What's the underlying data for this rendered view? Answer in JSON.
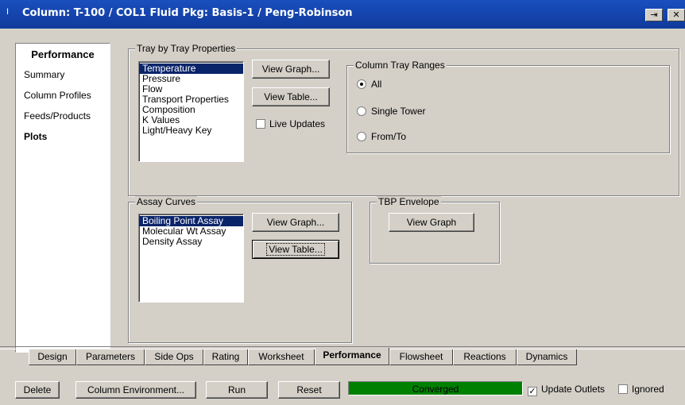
{
  "window": {
    "title": "Column: T-100 / COL1 Fluid Pkg: Basis-1 / Peng-Robinson",
    "app_icon": "I"
  },
  "sidebar": {
    "header": "Performance",
    "items": [
      {
        "label": "Summary"
      },
      {
        "label": "Column Profiles"
      },
      {
        "label": "Feeds/Products"
      },
      {
        "label": "Plots"
      }
    ],
    "active": "Plots"
  },
  "tray_props": {
    "legend": "Tray by Tray Properties",
    "items": [
      "Temperature",
      "Pressure",
      "Flow",
      "Transport Properties",
      "Composition",
      "K Values",
      "Light/Heavy Key"
    ],
    "selected": "Temperature",
    "view_graph": "View Graph...",
    "view_table": "View Table...",
    "live_updates": "Live Updates"
  },
  "tray_ranges": {
    "legend": "Column Tray Ranges",
    "options": [
      "All",
      "Single Tower",
      "From/To"
    ],
    "selected": "All"
  },
  "assay": {
    "legend": "Assay Curves",
    "items": [
      "Boiling Point Assay",
      "Molecular Wt Assay",
      "Density Assay"
    ],
    "selected": "Boiling Point Assay",
    "view_graph": "View Graph...",
    "view_table": "View Table..."
  },
  "tbp": {
    "legend": "TBP Envelope",
    "view_graph": "View Graph"
  },
  "tabs": [
    "Design",
    "Parameters",
    "Side Ops",
    "Rating",
    "Worksheet",
    "Performance",
    "Flowsheet",
    "Reactions",
    "Dynamics"
  ],
  "active_tab": "Performance",
  "footer": {
    "delete": "Delete",
    "col_env": "Column Environment...",
    "run": "Run",
    "reset": "Reset",
    "status": "Converged",
    "status_color": "#008000",
    "update_outlets": "Update Outlets",
    "update_outlets_checked": "✓",
    "ignored": "Ignored"
  },
  "colors": {
    "title_bar": "#1a4fbf",
    "selection": "#0a246a",
    "face": "#d4d0c8"
  }
}
